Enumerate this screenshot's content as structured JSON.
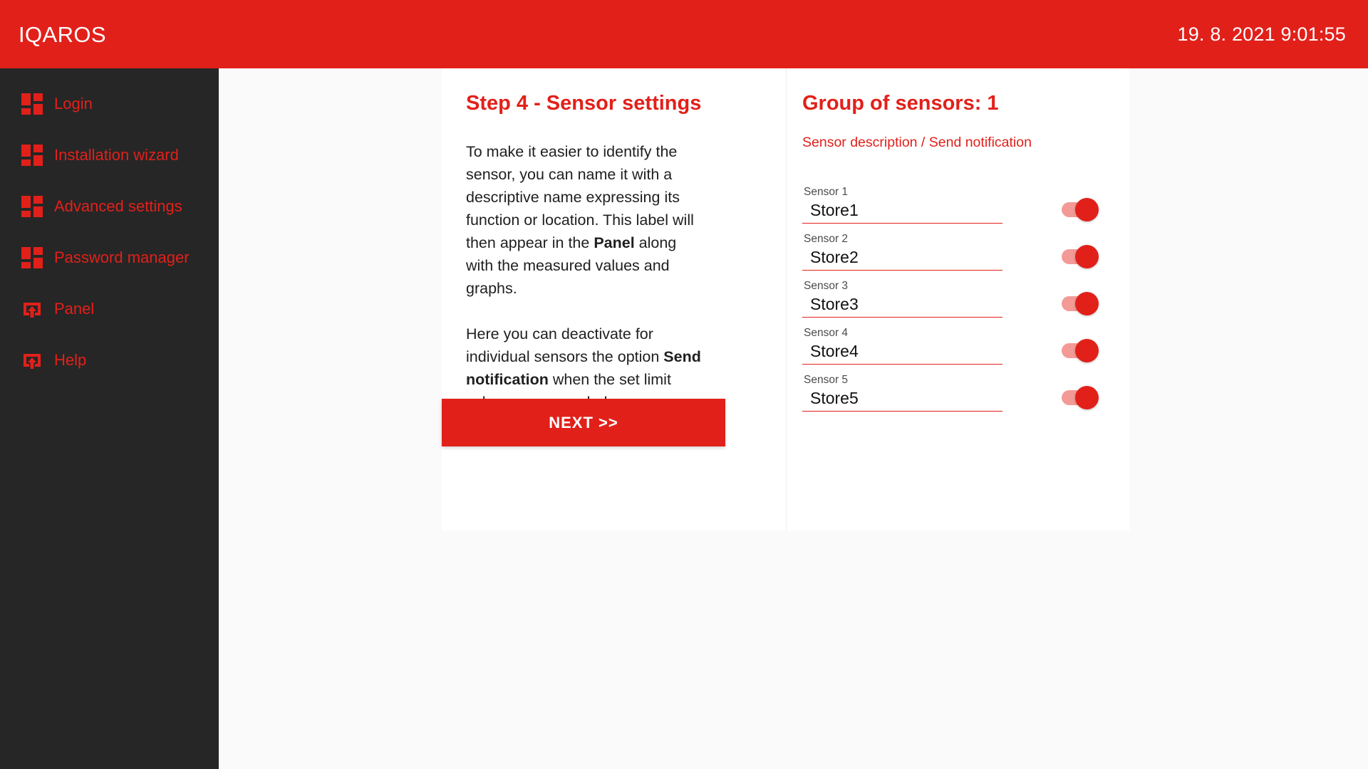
{
  "header": {
    "brand": "IQAROS",
    "datetime": "19. 8. 2021 9:01:55",
    "background_color": "#E2201A",
    "text_color": "#FFFFFF"
  },
  "sidebar": {
    "background_color": "#262626",
    "accent_color": "#E2201A",
    "items": [
      {
        "label": "Login",
        "icon": "tiles-icon"
      },
      {
        "label": "Installation wizard",
        "icon": "tiles-icon"
      },
      {
        "label": "Advanced settings",
        "icon": "tiles-icon"
      },
      {
        "label": "Password manager",
        "icon": "tiles-icon"
      },
      {
        "label": "Panel",
        "icon": "export-box-arrow-up-icon"
      },
      {
        "label": "Help",
        "icon": "export-box-arrow-up-icon"
      }
    ]
  },
  "wizard": {
    "step_title": "Step 4 - Sensor settings",
    "paragraph_1": {
      "part_1": "To make it easier to identify the sensor, you can name it with a descriptive name expressing its function or location. This label will then appear in the ",
      "bold_1": "Panel",
      "part_2": " along with the measured values and graphs."
    },
    "paragraph_2": {
      "part_1": "Here you can deactivate for individual sensors the option ",
      "bold_1": "Send notification",
      "part_2": " when the set limit values are exceeded."
    },
    "next_button": "NEXT >>"
  },
  "sensor_group": {
    "title": "Group of sensors: 1",
    "subtitle": "Sensor description / Send notification",
    "sensors": [
      {
        "label": "Sensor 1",
        "value": "Store1",
        "notification_enabled": true
      },
      {
        "label": "Sensor 2",
        "value": "Store2",
        "notification_enabled": true
      },
      {
        "label": "Sensor 3",
        "value": "Store3",
        "notification_enabled": true
      },
      {
        "label": "Sensor 4",
        "value": "Store4",
        "notification_enabled": true
      },
      {
        "label": "Sensor 5",
        "value": "Store5",
        "notification_enabled": true
      }
    ]
  }
}
